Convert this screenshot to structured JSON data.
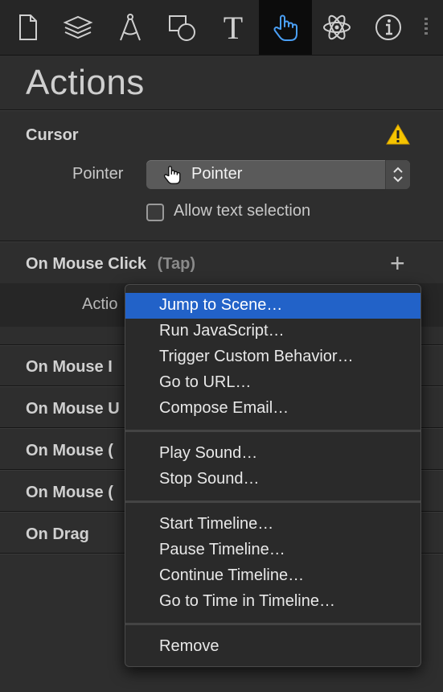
{
  "toolbar": {
    "tools": [
      {
        "name": "document-icon",
        "active": false
      },
      {
        "name": "layers-icon",
        "active": false
      },
      {
        "name": "compass-icon",
        "active": false
      },
      {
        "name": "shapes-icon",
        "active": false
      },
      {
        "name": "text-icon",
        "active": false
      },
      {
        "name": "hand-pointer-icon",
        "active": true
      },
      {
        "name": "atom-icon",
        "active": false
      },
      {
        "name": "info-icon",
        "active": false
      }
    ],
    "text_glyph": "T"
  },
  "panel": {
    "title": "Actions",
    "cursor": {
      "heading": "Cursor",
      "pointer_label": "Pointer",
      "pointer_value": "Pointer",
      "allow_text_selection": "Allow text selection",
      "allow_checked": false
    },
    "on_mouse_click": {
      "heading": "On Mouse Click",
      "tap": "(Tap)",
      "plus": "+",
      "action_label": "Actio"
    },
    "rows": [
      "On Mouse I",
      "On Mouse U",
      "On Mouse (",
      "On Mouse (",
      "On Drag"
    ]
  },
  "menu": {
    "groups": [
      [
        "Jump to Scene…",
        "Run JavaScript…",
        "Trigger Custom Behavior…",
        "Go to URL…",
        "Compose Email…"
      ],
      [
        "Play Sound…",
        "Stop Sound…"
      ],
      [
        "Start Timeline…",
        "Pause Timeline…",
        "Continue Timeline…",
        "Go to Time in Timeline…"
      ],
      [
        "Remove"
      ]
    ],
    "selected": "Jump to Scene…"
  },
  "colors": {
    "accent": "#2262c8",
    "active_tool": "#4a9ff5",
    "warning": "#f5c400"
  }
}
